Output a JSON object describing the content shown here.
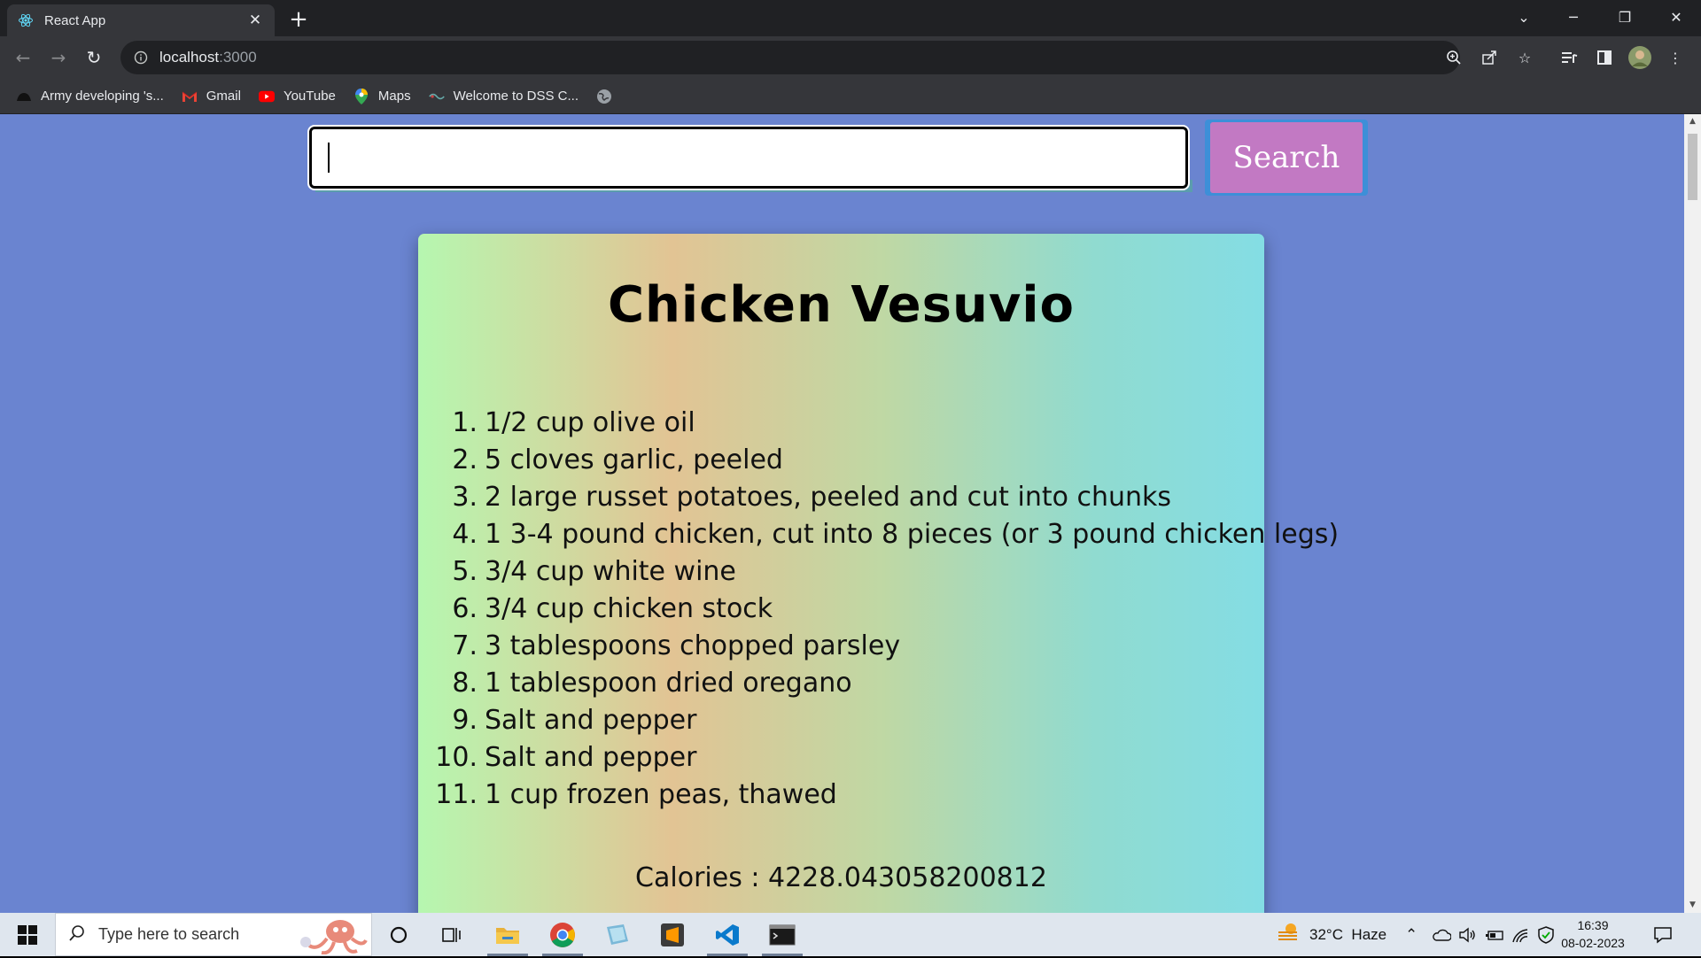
{
  "browser": {
    "tab_title": "React App",
    "url_host": "localhost",
    "url_port": ":3000",
    "bookmarks": [
      {
        "label": "Army developing 's...",
        "icon": "army-icon"
      },
      {
        "label": "Gmail",
        "icon": "gmail-icon"
      },
      {
        "label": "YouTube",
        "icon": "youtube-icon"
      },
      {
        "label": "Maps",
        "icon": "maps-icon"
      },
      {
        "label": "Welcome to DSS C...",
        "icon": "dss-icon"
      }
    ]
  },
  "search": {
    "value": "",
    "button_label": "Search"
  },
  "recipe": {
    "title": "Chicken Vesuvio",
    "ingredients": [
      {
        "num": "1.",
        "text": "1/2 cup olive oil"
      },
      {
        "num": "2.",
        "text": "5 cloves garlic, peeled"
      },
      {
        "num": "3.",
        "text": "2 large russet potatoes, peeled and cut into chunks"
      },
      {
        "num": "4.",
        "text": "1 3-4 pound chicken, cut into 8 pieces (or 3 pound chicken legs)"
      },
      {
        "num": "5.",
        "text": "3/4 cup white wine"
      },
      {
        "num": "6.",
        "text": "3/4 cup chicken stock"
      },
      {
        "num": "7.",
        "text": "3 tablespoons chopped parsley"
      },
      {
        "num": "8.",
        "text": "1 tablespoon dried oregano"
      },
      {
        "num": "9.",
        "text": "Salt and pepper"
      },
      {
        "num": "10.",
        "text": "Salt and pepper"
      },
      {
        "num": "11.",
        "text": "1 cup frozen peas, thawed"
      }
    ],
    "calories_text": "Calories : 4228.043058200812"
  },
  "taskbar": {
    "search_placeholder": "Type here to search",
    "weather": "32°C  Haze",
    "time": "16:39",
    "date": "08-02-2023"
  },
  "colors": {
    "page_bg": "#6a84d0",
    "button_bg": "#c279c3",
    "button_border": "#3d8fd8"
  }
}
